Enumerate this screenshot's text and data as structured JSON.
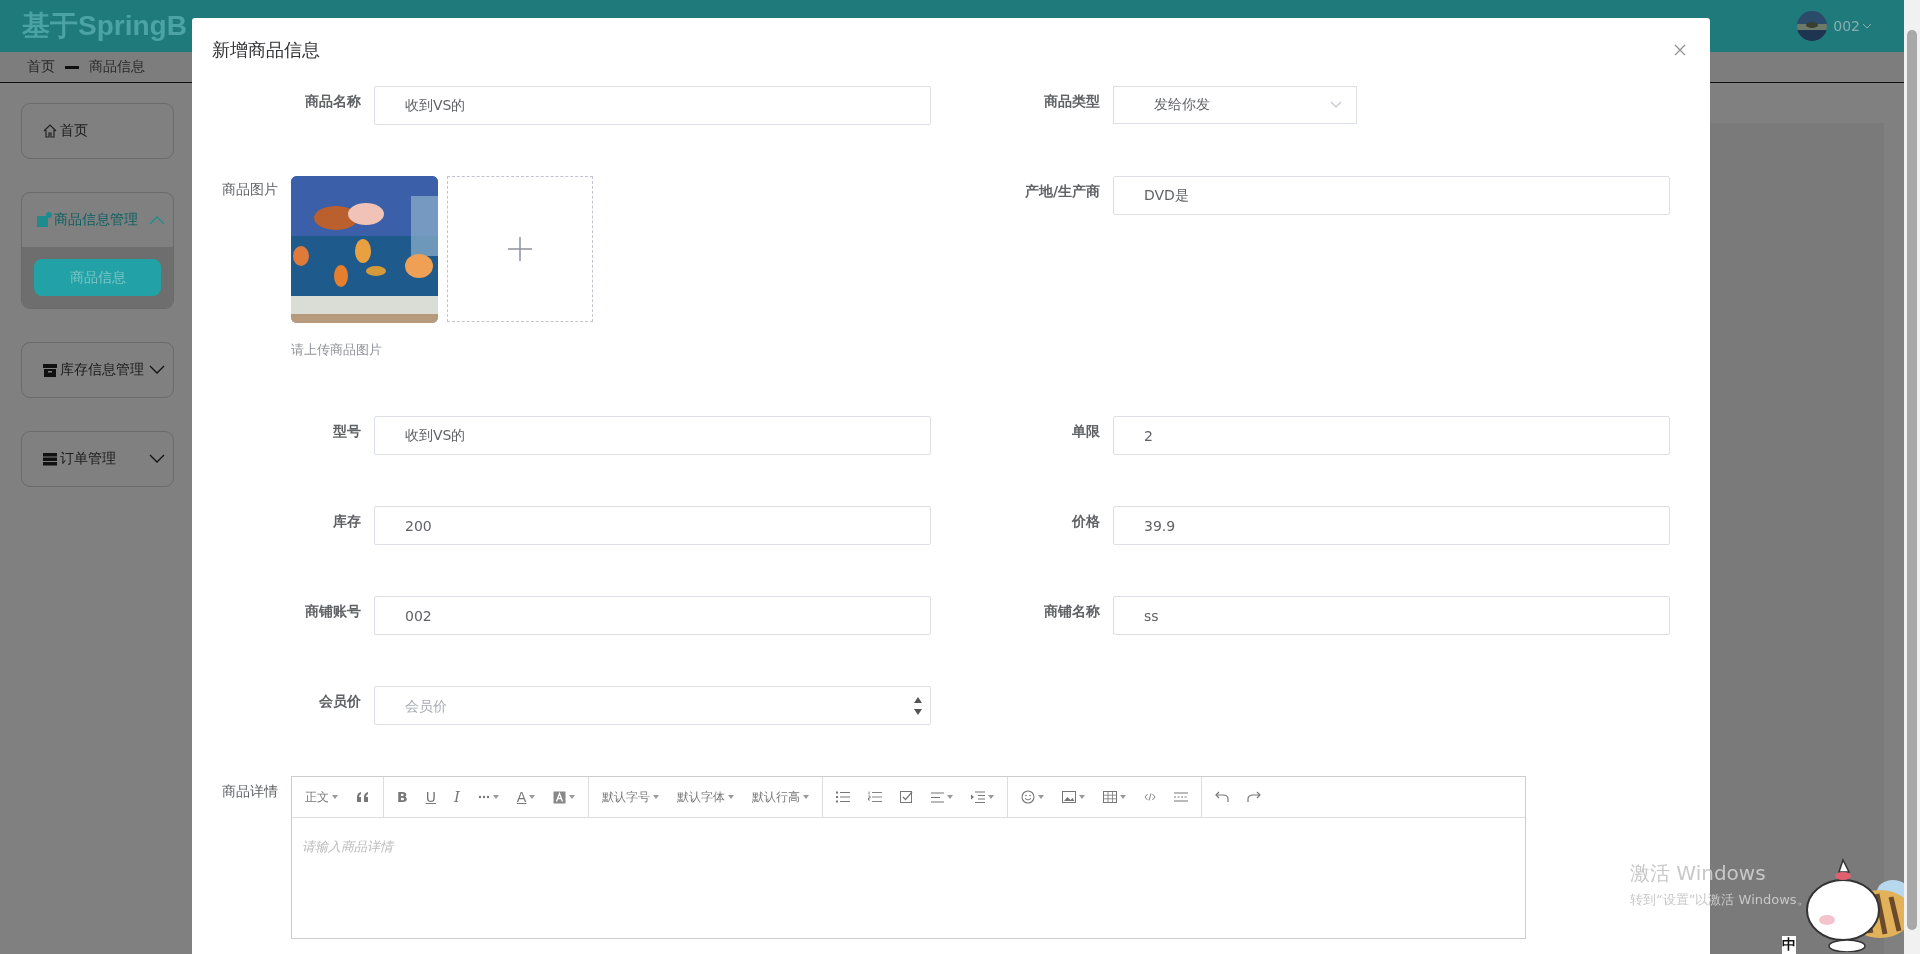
{
  "header": {
    "title": "基于SpringB",
    "user": "002"
  },
  "breadcrumb": [
    "首页",
    "商品信息"
  ],
  "sidebar": {
    "items": [
      {
        "label": "首页",
        "kind": "home"
      },
      {
        "label": "商品信息管理",
        "kind": "goods",
        "expanded": true,
        "children": [
          {
            "label": "商品信息",
            "selected": true
          }
        ]
      },
      {
        "label": "库存信息管理",
        "kind": "stock",
        "expanded": false
      },
      {
        "label": "订单管理",
        "kind": "order",
        "expanded": false
      }
    ]
  },
  "dialog": {
    "title": "新增商品信息",
    "fields": [
      {
        "label": "商品名称",
        "kind": "text",
        "value": "收到VS的"
      },
      {
        "label": "商品类型",
        "kind": "select",
        "value": "发给你发"
      },
      {
        "label": "商品图片",
        "kind": "upload",
        "hint": "请上传商品图片"
      },
      {
        "label": "产地/生产商",
        "kind": "text",
        "value": "DVD是"
      },
      {
        "label": "型号",
        "kind": "text",
        "value": "收到VS的"
      },
      {
        "label": "单限",
        "kind": "text",
        "value": "2"
      },
      {
        "label": "库存",
        "kind": "text",
        "value": "200"
      },
      {
        "label": "价格",
        "kind": "text",
        "value": "39.9"
      },
      {
        "label": "商铺账号",
        "kind": "text",
        "value": "002"
      },
      {
        "label": "商铺名称",
        "kind": "text",
        "value": "ss"
      },
      {
        "label": "会员价",
        "kind": "number",
        "placeholder": "会员价"
      },
      {
        "label": "商品详情",
        "kind": "editor",
        "toolbar": [
          "正文",
          "B",
          "U",
          "I",
          "A",
          "默认字号",
          "默认字体",
          "默认行高"
        ],
        "placeholder": "请输入商品详情"
      }
    ]
  },
  "system_notice": {
    "title": "激活 Windows",
    "text": "转到“设置”以激活 Windows。",
    "ime": "中"
  }
}
